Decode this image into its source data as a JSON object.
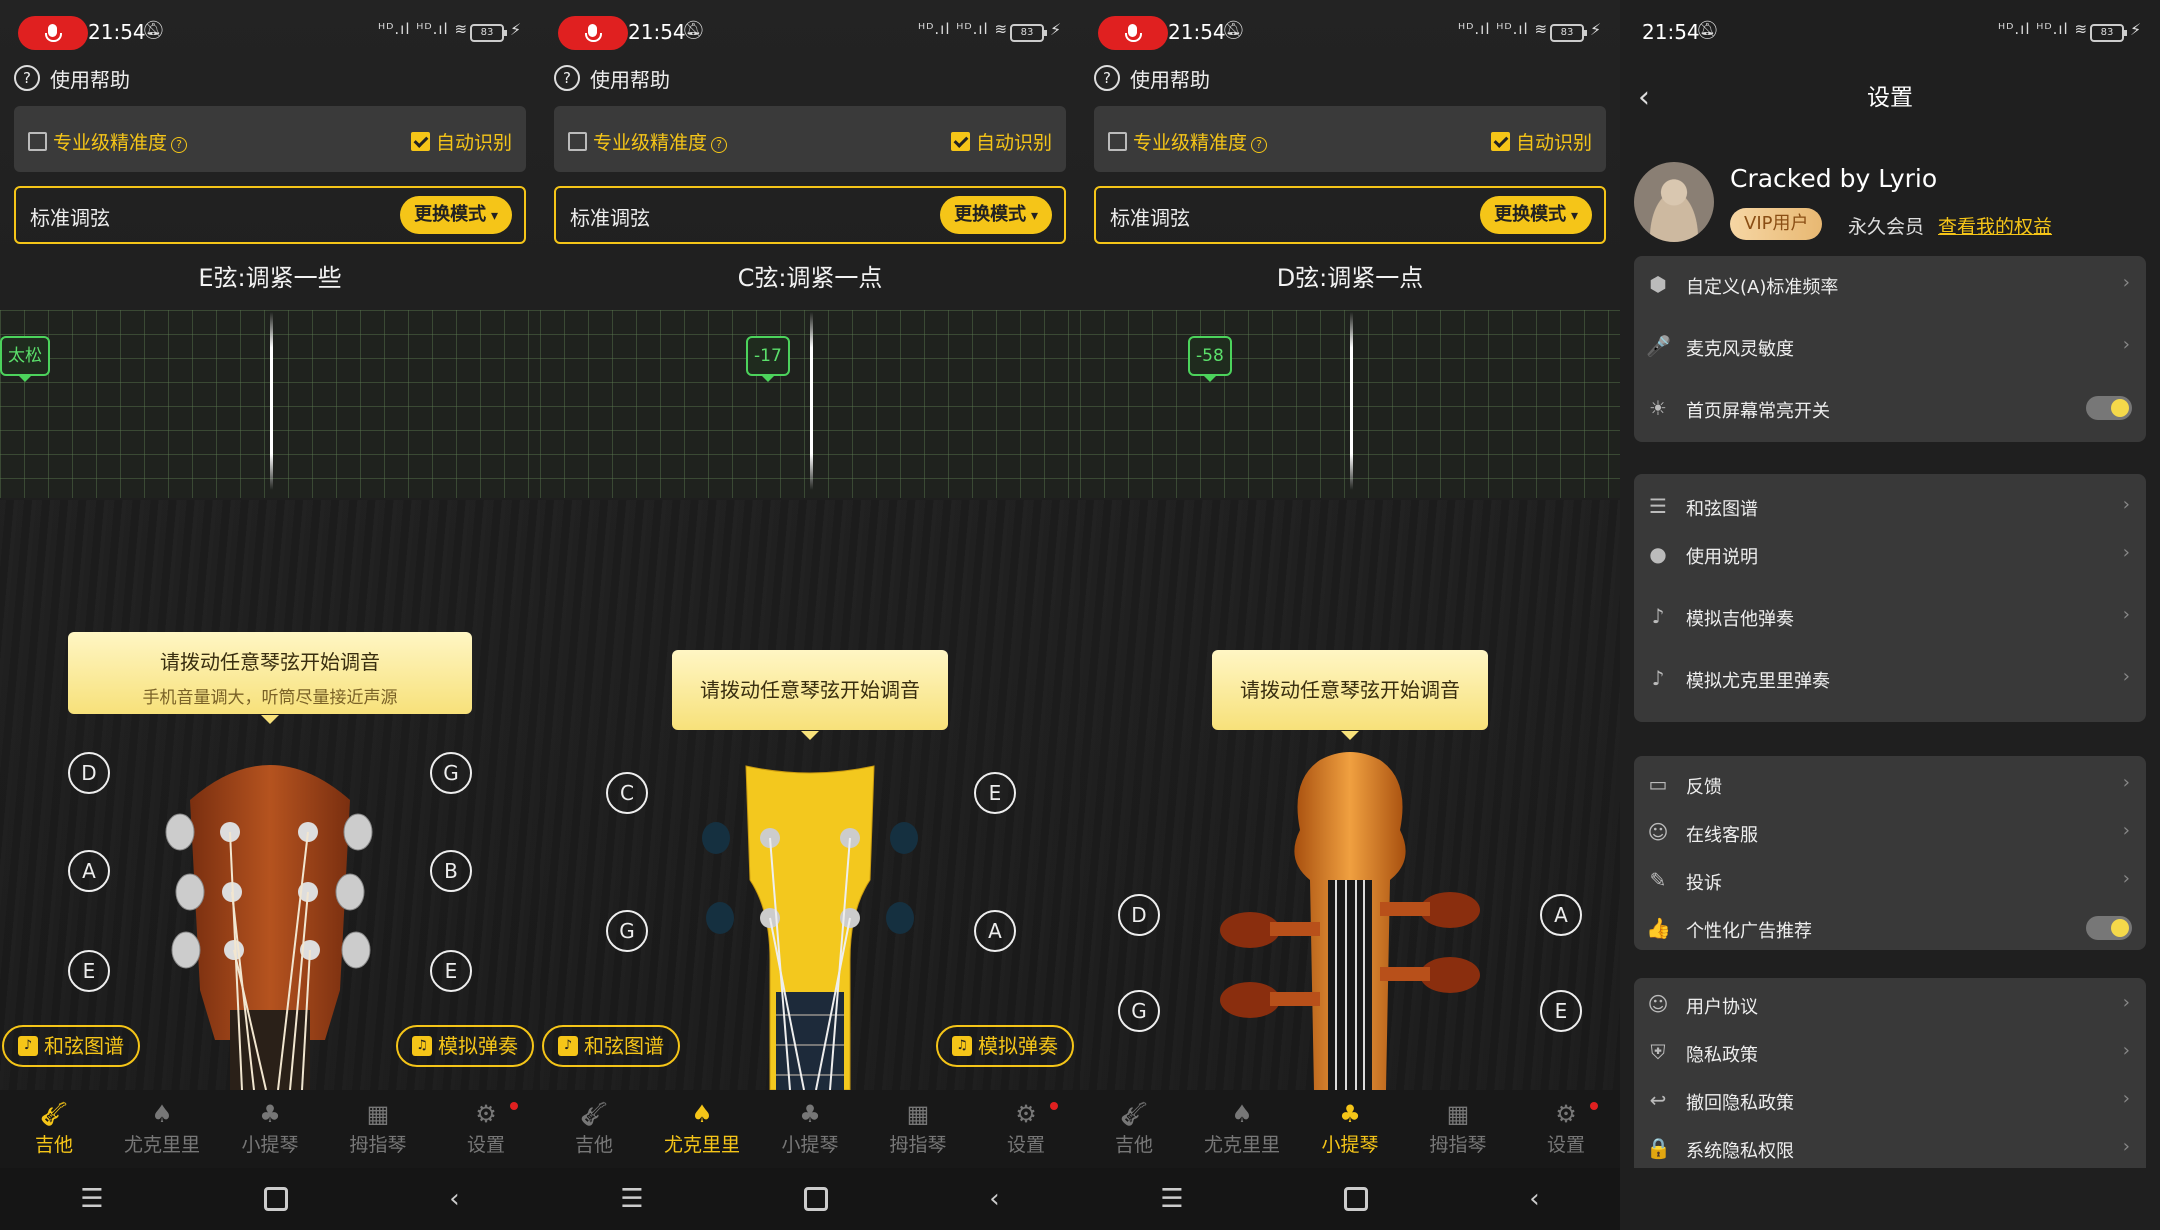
{
  "status": {
    "time": "21:54",
    "signal": "ᴴᴰ.ıl ᴴᴰ.ıl ≋",
    "battery": "83",
    "mute_icon": "bell-off",
    "bolt": "⚡"
  },
  "common": {
    "help_label": "使用帮助",
    "pro_accuracy": "专业级精准度",
    "auto_detect": "自动识别",
    "tuning_label": "标准调弦",
    "mode_button": "更换模式",
    "chord_chart": "和弦图谱",
    "simulate_play": "模拟弹奏",
    "tabs": [
      "吉他",
      "尤克里里",
      "小提琴",
      "拇指琴",
      "设置"
    ]
  },
  "guitar": {
    "note_text": "E弦:调紧一些",
    "marker": "太松",
    "bubble_title": "请拨动任意琴弦开始调音",
    "bubble_sub": "手机音量调大，听筒尽量接近声源",
    "strings_left": [
      "D",
      "A",
      "E"
    ],
    "strings_right": [
      "G",
      "B",
      "E"
    ]
  },
  "ukulele": {
    "note_text": "C弦:调紧一点",
    "marker": "-17",
    "bubble_title": "请拨动任意琴弦开始调音",
    "strings_left": [
      "C",
      "G"
    ],
    "strings_right": [
      "E",
      "A"
    ]
  },
  "violin": {
    "note_text": "D弦:调紧一点",
    "marker": "-58",
    "bubble_title": "请拨动任意琴弦开始调音",
    "strings_left": [
      "D",
      "G"
    ],
    "strings_right": [
      "A",
      "E"
    ]
  },
  "settings": {
    "title": "设置",
    "user_name": "Cracked by Lyrio",
    "vip_badge": "VIP用户",
    "membership": "永久会员",
    "view_rights": "查看我的权益",
    "group1": [
      {
        "label": "自定义(A)标准频率",
        "icon": "cube-icon",
        "glyph": "⬢",
        "type": "link"
      },
      {
        "label": "麦克风灵敏度",
        "icon": "mic-icon",
        "glyph": "🎤",
        "type": "link"
      },
      {
        "label": "首页屏幕常亮开关",
        "icon": "sun-icon",
        "glyph": "☀",
        "type": "toggle"
      }
    ],
    "group2": [
      {
        "label": "和弦图谱",
        "icon": "chord-icon",
        "glyph": "☰",
        "type": "link"
      },
      {
        "label": "使用说明",
        "icon": "bulb-icon",
        "glyph": "●",
        "type": "link"
      },
      {
        "label": "模拟吉他弹奏",
        "icon": "guitar-icon",
        "glyph": "♪",
        "type": "link"
      },
      {
        "label": "模拟尤克里里弹奏",
        "icon": "ukulele-icon",
        "glyph": "♪",
        "type": "link"
      }
    ],
    "group3": [
      {
        "label": "反馈",
        "icon": "feedback-icon",
        "glyph": "▭",
        "type": "link"
      },
      {
        "label": "在线客服",
        "icon": "service-icon",
        "glyph": "☺",
        "type": "link"
      },
      {
        "label": "投诉",
        "icon": "complain-icon",
        "glyph": "✎",
        "type": "link"
      },
      {
        "label": "个性化广告推荐",
        "icon": "thumb-icon",
        "glyph": "👍",
        "type": "toggle"
      }
    ],
    "group4": [
      {
        "label": "用户协议",
        "icon": "user-icon",
        "glyph": "☺",
        "type": "link"
      },
      {
        "label": "隐私政策",
        "icon": "shield-icon",
        "glyph": "⛨",
        "type": "link"
      },
      {
        "label": "撤回隐私政策",
        "icon": "revoke-icon",
        "glyph": "↩",
        "type": "link"
      },
      {
        "label": "系统隐私权限",
        "icon": "lock-icon",
        "glyph": "🔒",
        "type": "link"
      }
    ]
  },
  "colors": {
    "accent": "#f5c518",
    "marker": "#4cd35c",
    "record": "#e02020"
  }
}
